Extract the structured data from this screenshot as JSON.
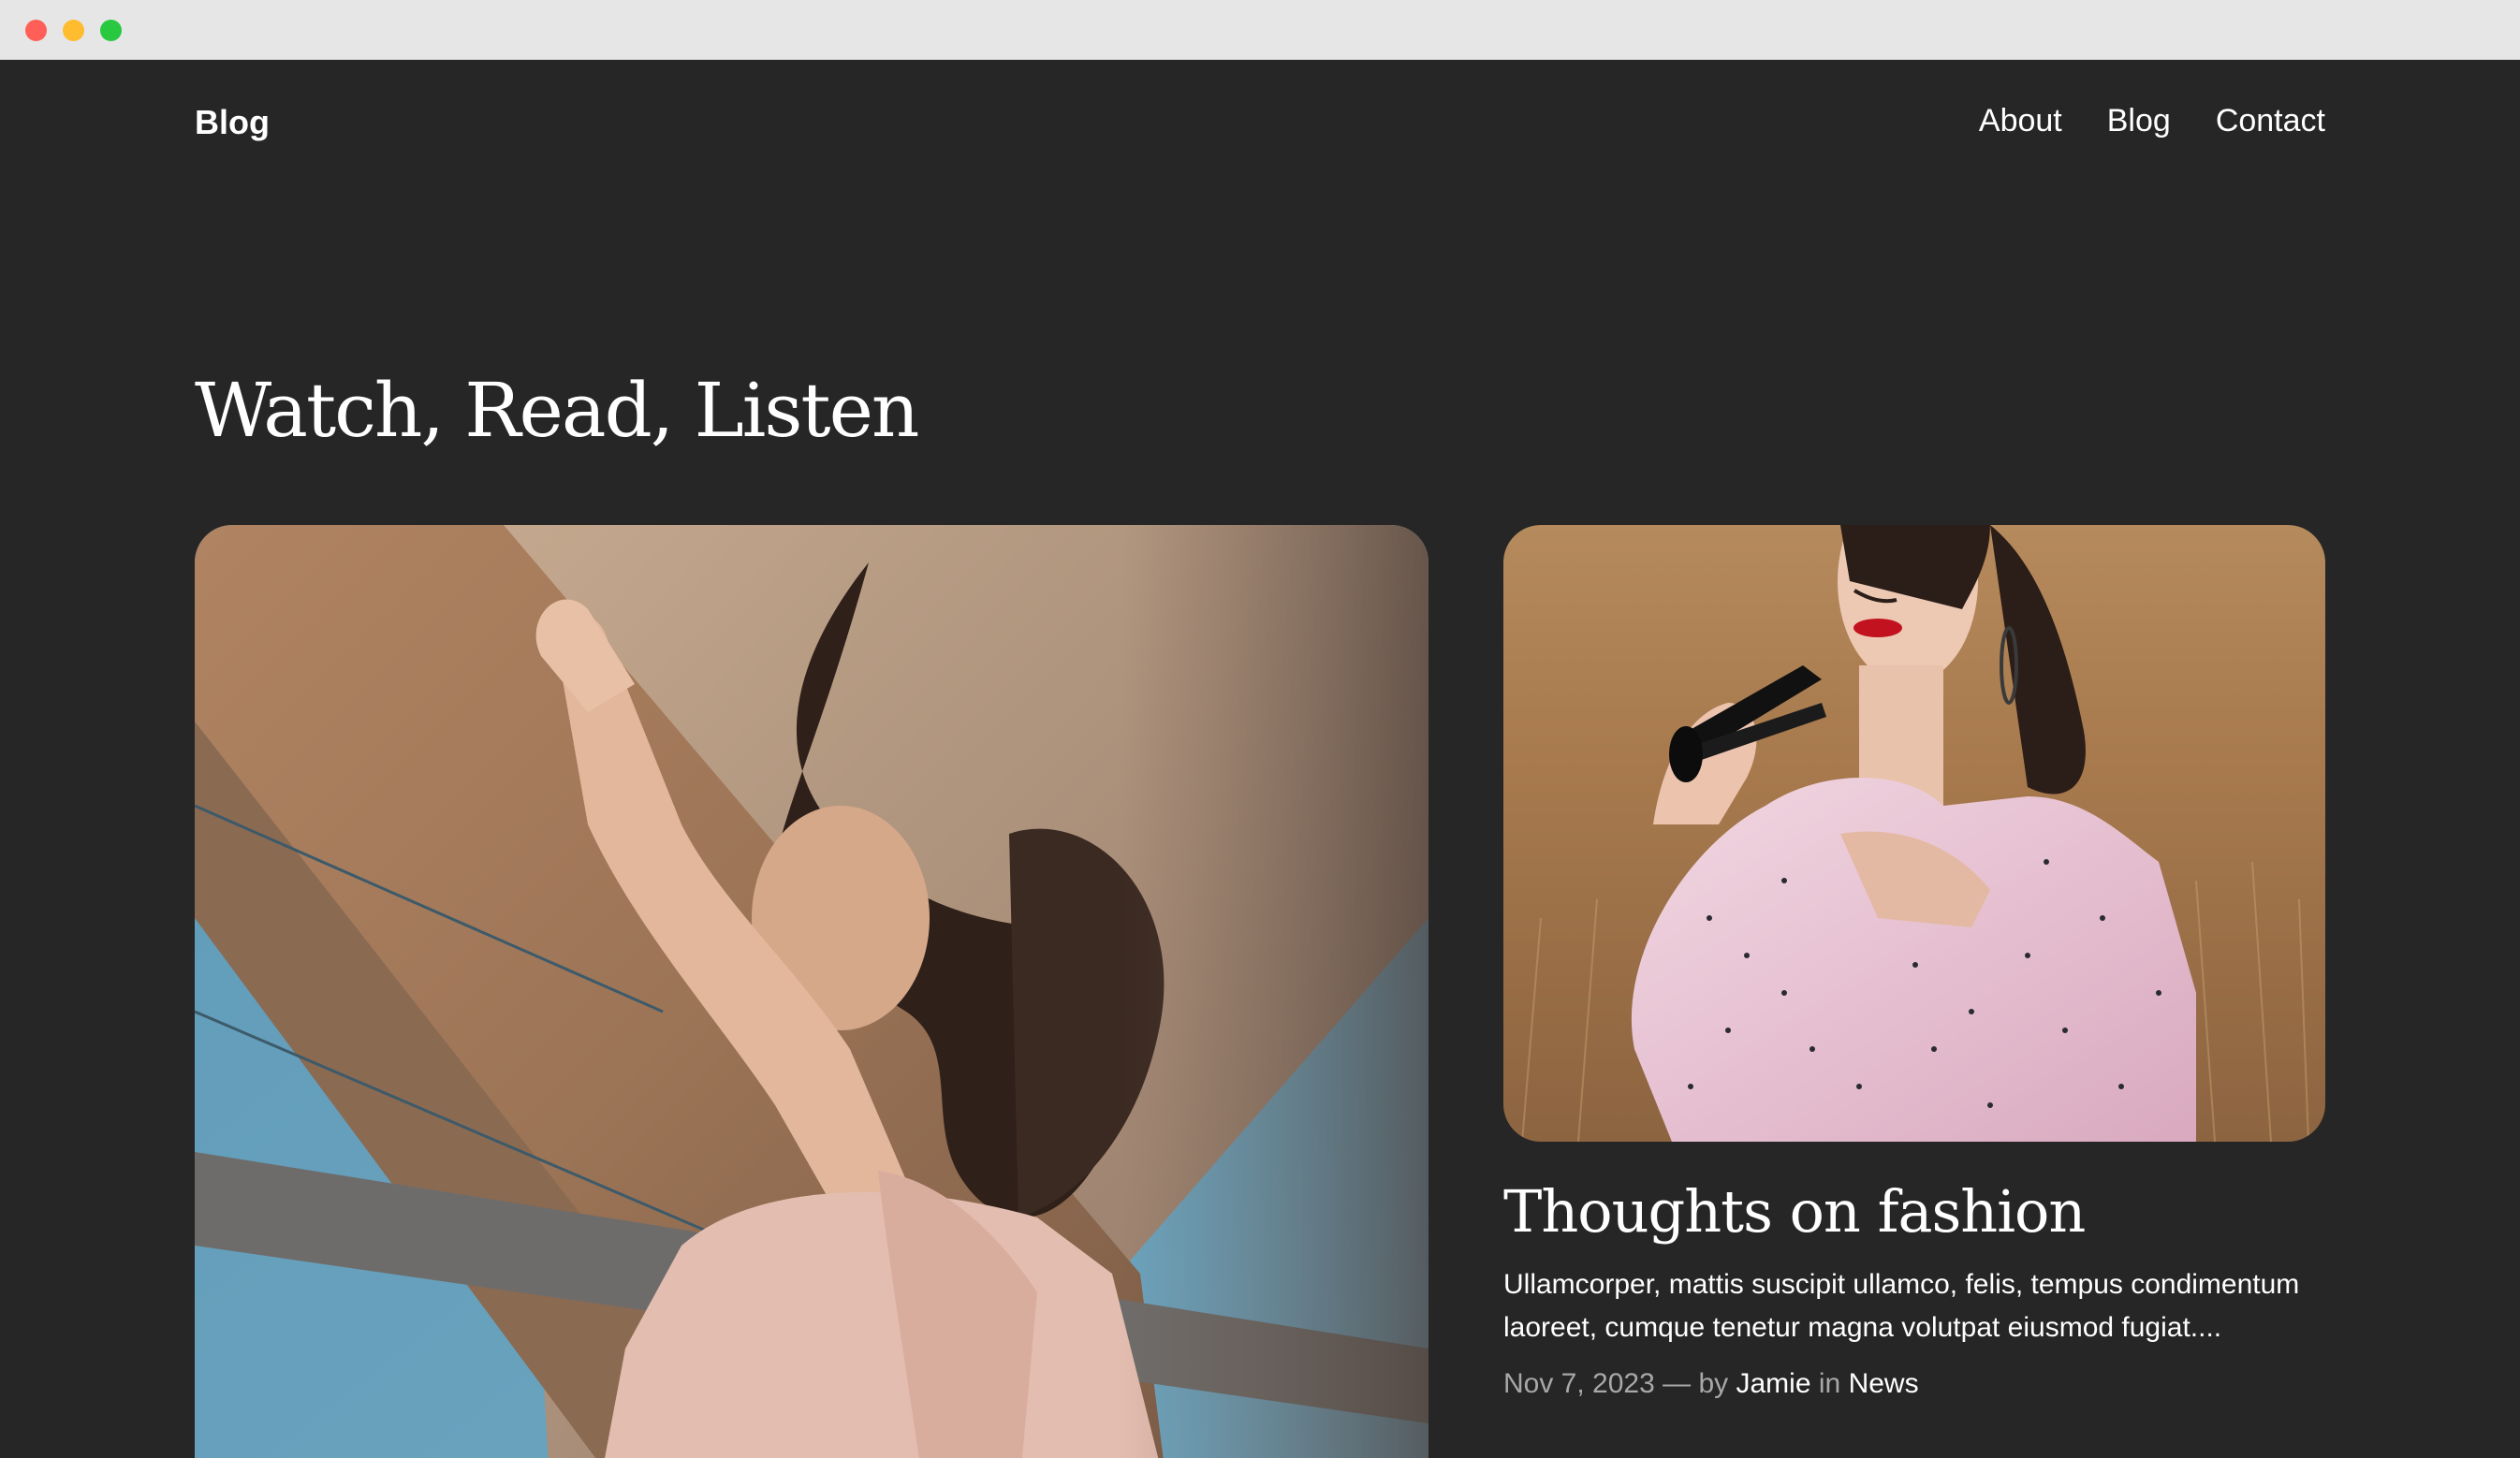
{
  "window": {
    "controls": [
      "close-button",
      "minimize-button",
      "zoom-button"
    ],
    "colors": {
      "close": "#ff5f57",
      "minimize": "#febc2e",
      "zoom": "#28c840"
    }
  },
  "header": {
    "site_title": "Blog",
    "nav": [
      {
        "label": "About"
      },
      {
        "label": "Blog"
      },
      {
        "label": "Contact"
      }
    ]
  },
  "main": {
    "heading": "Watch, Read, Listen",
    "posts": [
      {
        "image_alt": "Woman with windblown hair reaching toward the sky beneath a bridge"
      },
      {
        "image_alt": "Woman in pink polka-dot ruffled dress holding sunglasses in a wheat field",
        "title": "Thoughts on fashion",
        "excerpt": "Ullamcorper, mattis suscipit ullamco, felis, tempus condimentum laoreet, cumque tenetur magna volutpat eiusmod fugiat....",
        "date": "Nov 7, 2023",
        "separator": "—",
        "by_label": "by",
        "author": "Jamie",
        "in_label": "in",
        "category": "News"
      }
    ]
  },
  "theme": {
    "background": "#262626",
    "text": "#ffffff",
    "muted": "#a8a8a8"
  }
}
